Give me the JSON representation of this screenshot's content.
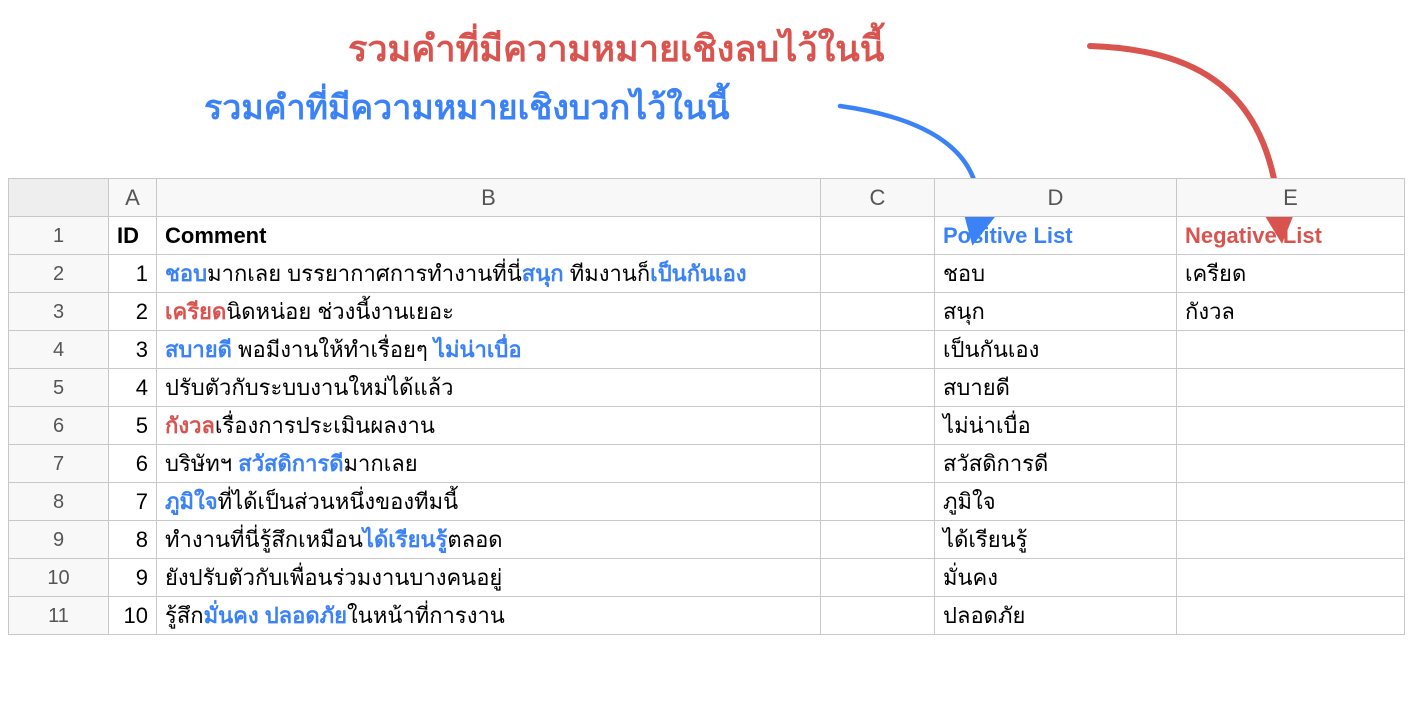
{
  "annotations": {
    "red": "รวมคำที่มีความหมายเชิงลบไว้ในนี้",
    "blue": "รวมคำที่มีความหมายเชิงบวกไว้ในนี้"
  },
  "colors": {
    "positive": "#3b82f6",
    "negative": "#d9534f"
  },
  "columns": {
    "blank": "",
    "A": "A",
    "B": "B",
    "C": "C",
    "D": "D",
    "E": "E"
  },
  "headers": {
    "id": "ID",
    "comment": "Comment",
    "c": "",
    "positive": "Positive List",
    "negative": "Negative List"
  },
  "rows": [
    {
      "n": "1",
      "id": "1",
      "comment_parts": [
        {
          "t": "ชอบ",
          "s": "pos"
        },
        {
          "t": "มากเลย บรรยากาศการทำงานที่นี่",
          "s": ""
        },
        {
          "t": "สนุก",
          "s": "pos"
        },
        {
          "t": " ทีมงานก็",
          "s": ""
        },
        {
          "t": "เป็นกันเอง",
          "s": "pos"
        }
      ],
      "c": "",
      "pos": "ชอบ",
      "neg": "เครียด"
    },
    {
      "n": "2",
      "id": "2",
      "comment_parts": [
        {
          "t": "เครียด",
          "s": "neg"
        },
        {
          "t": "นิดหน่อย ช่วงนี้งานเยอะ",
          "s": ""
        }
      ],
      "c": "",
      "pos": "สนุก",
      "neg": "กังวล"
    },
    {
      "n": "3",
      "id": "3",
      "comment_parts": [
        {
          "t": "สบายดี",
          "s": "pos"
        },
        {
          "t": " พอมีงานให้ทำเรื่อยๆ ",
          "s": ""
        },
        {
          "t": "ไม่น่าเบื่อ",
          "s": "pos"
        }
      ],
      "c": "",
      "pos": "เป็นกันเอง",
      "neg": ""
    },
    {
      "n": "4",
      "id": "4",
      "comment_parts": [
        {
          "t": "ปรับตัวกับระบบงานใหม่ได้แล้ว",
          "s": ""
        }
      ],
      "c": "",
      "pos": "สบายดี",
      "neg": ""
    },
    {
      "n": "5",
      "id": "5",
      "comment_parts": [
        {
          "t": "กังวล",
          "s": "neg"
        },
        {
          "t": "เรื่องการประเมินผลงาน",
          "s": ""
        }
      ],
      "c": "",
      "pos": "ไม่น่าเบื่อ",
      "neg": ""
    },
    {
      "n": "6",
      "id": "6",
      "comment_parts": [
        {
          "t": "บริษัทฯ ",
          "s": ""
        },
        {
          "t": "สวัสดิการดี",
          "s": "pos"
        },
        {
          "t": "มากเลย",
          "s": ""
        }
      ],
      "c": "",
      "pos": "สวัสดิการดี",
      "neg": ""
    },
    {
      "n": "7",
      "id": "7",
      "comment_parts": [
        {
          "t": "ภูมิใจ",
          "s": "pos"
        },
        {
          "t": "ที่ได้เป็นส่วนหนึ่งของทีมนี้",
          "s": ""
        }
      ],
      "c": "",
      "pos": "ภูมิใจ",
      "neg": ""
    },
    {
      "n": "8",
      "id": "8",
      "comment_parts": [
        {
          "t": "ทำงานที่นี่รู้สึกเหมือน",
          "s": ""
        },
        {
          "t": "ได้เรียนรู้",
          "s": "pos"
        },
        {
          "t": "ตลอด",
          "s": ""
        }
      ],
      "c": "",
      "pos": "ได้เรียนรู้",
      "neg": ""
    },
    {
      "n": "9",
      "id": "9",
      "comment_parts": [
        {
          "t": "ยังปรับตัวกับเพื่อนร่วมงานบางคนอยู่",
          "s": ""
        }
      ],
      "c": "",
      "pos": "มั่นคง",
      "neg": ""
    },
    {
      "n": "10",
      "id": "10",
      "comment_parts": [
        {
          "t": "รู้สึก",
          "s": ""
        },
        {
          "t": "มั่นคง ปลอดภัย",
          "s": "pos"
        },
        {
          "t": "ในหน้าที่การงาน",
          "s": ""
        }
      ],
      "c": "",
      "pos": "ปลอดภัย",
      "neg": ""
    }
  ],
  "rowNumbers": [
    "1",
    "2",
    "3",
    "4",
    "5",
    "6",
    "7",
    "8",
    "9",
    "10",
    "11"
  ]
}
